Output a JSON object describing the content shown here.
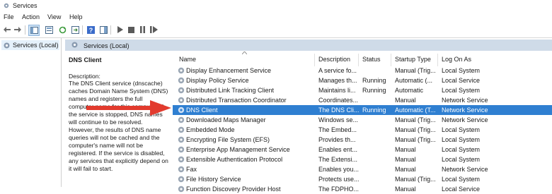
{
  "window": {
    "title": "Services",
    "icon": "services-gear-icon"
  },
  "menu": [
    "File",
    "Action",
    "View",
    "Help"
  ],
  "toolbar": {
    "buttons": [
      "back-icon",
      "forward-icon",
      "show-hide-console-tree-icon",
      "properties-icon",
      "refresh-icon",
      "export-list-icon",
      "help-icon",
      "view-icon",
      "start-icon",
      "stop-icon",
      "pause-icon",
      "restart-icon"
    ]
  },
  "tree": {
    "item": "Services (Local)"
  },
  "header": {
    "title": "Services (Local)"
  },
  "description": {
    "service_name": "DNS Client",
    "label": "Description:",
    "lines": [
      "The DNS Client service (dnscache)",
      "caches Domain Name System (DNS)",
      "names and registers the full",
      "computer name for this computer. If",
      "the service is stopped, DNS names",
      "will continue to be resolved.",
      "However, the results of DNS name",
      "queries will not be cached and the",
      "computer's name will not be",
      "registered. If the service is disabled,",
      "any services that explicitly depend on",
      "it will fail to start."
    ]
  },
  "columns": [
    "Name",
    "Description",
    "Status",
    "Startup Type",
    "Log On As"
  ],
  "rows": [
    {
      "name": "Display Enhancement Service",
      "description": "A service fo...",
      "status": "",
      "startup": "Manual (Trig...",
      "logon": "Local System"
    },
    {
      "name": "Display Policy Service",
      "description": "Manages th...",
      "status": "Running",
      "startup": "Automatic (...",
      "logon": "Local Service"
    },
    {
      "name": "Distributed Link Tracking Client",
      "description": "Maintains li...",
      "status": "Running",
      "startup": "Automatic",
      "logon": "Local System"
    },
    {
      "name": "Distributed Transaction Coordinator",
      "description": "Coordinates...",
      "status": "",
      "startup": "Manual",
      "logon": "Network Service"
    },
    {
      "name": "DNS Client",
      "description": "The DNS Cli...",
      "status": "Running",
      "startup": "Automatic (T...",
      "logon": "Network Service",
      "selected": true
    },
    {
      "name": "Downloaded Maps Manager",
      "description": "Windows se...",
      "status": "",
      "startup": "Manual (Trig...",
      "logon": "Network Service"
    },
    {
      "name": "Embedded Mode",
      "description": "The Embed...",
      "status": "",
      "startup": "Manual (Trig...",
      "logon": "Local System"
    },
    {
      "name": "Encrypting File System (EFS)",
      "description": "Provides th...",
      "status": "",
      "startup": "Manual (Trig...",
      "logon": "Local System"
    },
    {
      "name": "Enterprise App Management Service",
      "description": "Enables ent...",
      "status": "",
      "startup": "Manual",
      "logon": "Local System"
    },
    {
      "name": "Extensible Authentication Protocol",
      "description": "The Extensi...",
      "status": "",
      "startup": "Manual",
      "logon": "Local System"
    },
    {
      "name": "Fax",
      "description": "Enables you...",
      "status": "",
      "startup": "Manual",
      "logon": "Network Service"
    },
    {
      "name": "File History Service",
      "description": "Protects use...",
      "status": "",
      "startup": "Manual (Trig...",
      "logon": "Local System"
    },
    {
      "name": "Function Discovery Provider Host",
      "description": "The FDPHO...",
      "status": "",
      "startup": "Manual",
      "logon": "Local Service"
    }
  ],
  "colors": {
    "selection": "#2f7fd1",
    "arrow": "#e23b2e",
    "header_strip": "#cfdbe8"
  }
}
